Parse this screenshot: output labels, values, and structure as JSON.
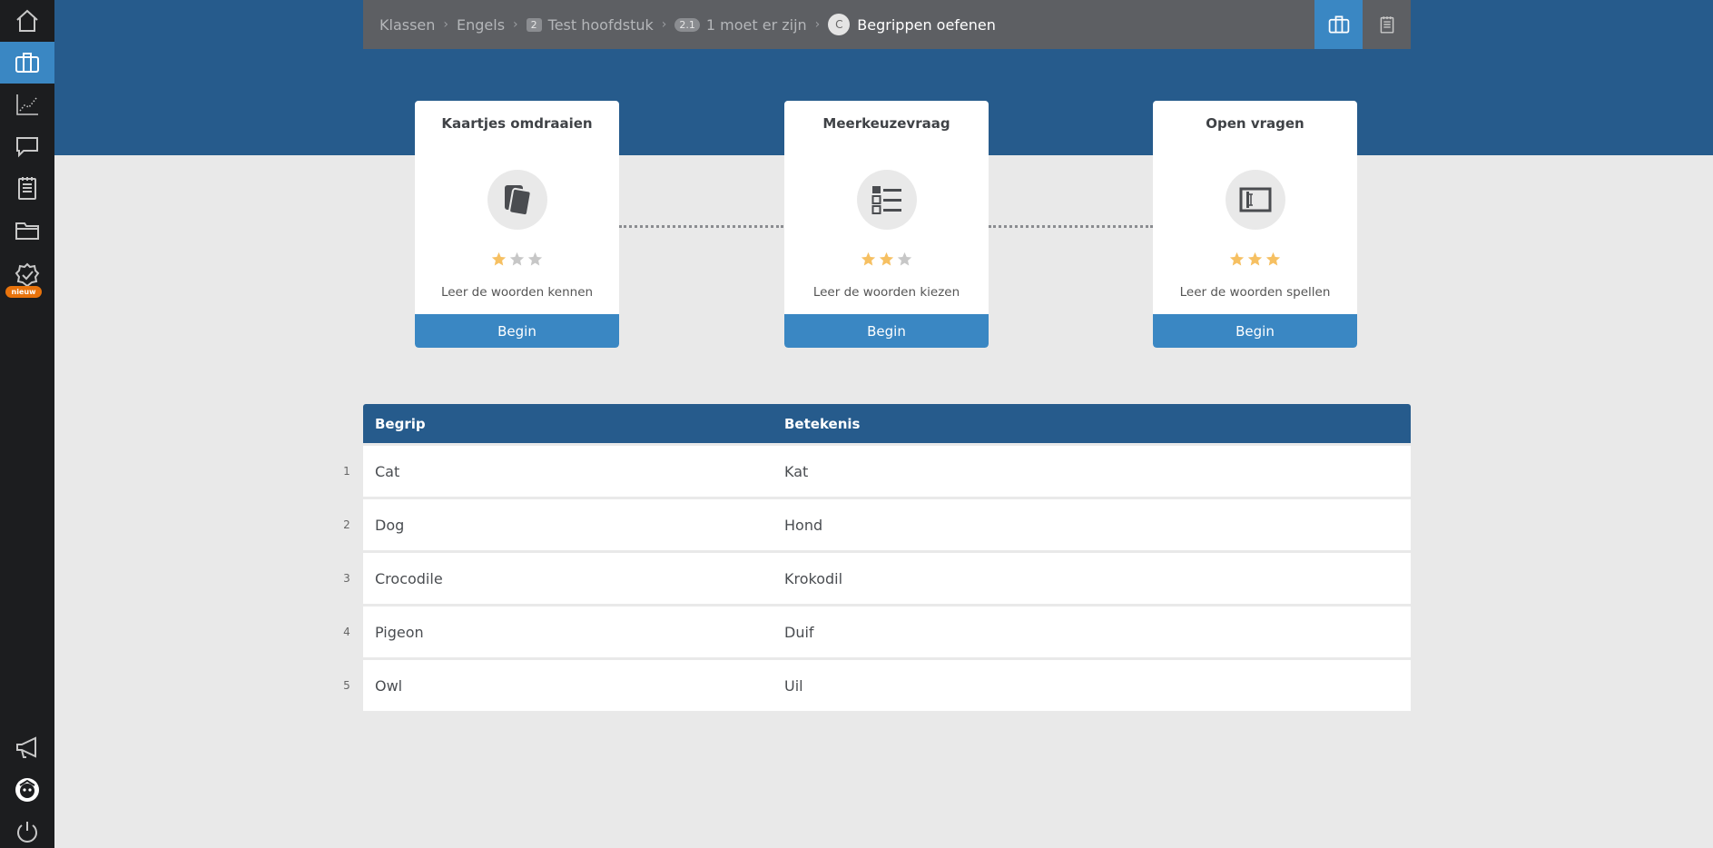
{
  "sidebar": {
    "items": [
      {
        "name": "home-icon"
      },
      {
        "name": "briefcase-icon",
        "active": true
      },
      {
        "name": "chart-icon"
      },
      {
        "name": "chat-icon"
      },
      {
        "name": "notepad-icon"
      },
      {
        "name": "folder-icon"
      },
      {
        "name": "badge-check-icon",
        "badge": "nieuw"
      },
      {
        "name": "megaphone-icon"
      },
      {
        "name": "avatar-icon"
      },
      {
        "name": "power-icon"
      }
    ]
  },
  "breadcrumb": {
    "items": [
      {
        "label": "Klassen"
      },
      {
        "label": "Engels"
      },
      {
        "pill": "2",
        "label": "Test hoofdstuk"
      },
      {
        "pill": "2.1",
        "label": "1 moet er zijn"
      },
      {
        "circle": "C",
        "label": "Begrippen oefenen"
      }
    ]
  },
  "modes": [
    {
      "title": "Kaartjes omdraaien",
      "icon": "cards-icon",
      "stars": 1,
      "max_stars": 3,
      "desc": "Leer de woorden kennen",
      "button": "Begin"
    },
    {
      "title": "Meerkeuzevraag",
      "icon": "list-icon",
      "stars": 2,
      "max_stars": 3,
      "desc": "Leer de woorden kiezen",
      "button": "Begin"
    },
    {
      "title": "Open vragen",
      "icon": "text-input-icon",
      "stars": 3,
      "max_stars": 3,
      "desc": "Leer de woorden spellen",
      "button": "Begin"
    }
  ],
  "table": {
    "headers": [
      "Begrip",
      "Betekenis"
    ],
    "rows": [
      {
        "n": "1",
        "term": "Cat",
        "meaning": "Kat"
      },
      {
        "n": "2",
        "term": "Dog",
        "meaning": "Hond"
      },
      {
        "n": "3",
        "term": "Crocodile",
        "meaning": "Krokodil"
      },
      {
        "n": "4",
        "term": "Pigeon",
        "meaning": "Duif"
      },
      {
        "n": "5",
        "term": "Owl",
        "meaning": "Uil"
      }
    ]
  },
  "colors": {
    "primary": "#3a87c3",
    "header": "#265b8c",
    "star_on": "#f6c062",
    "star_off": "#c7c7c7",
    "badge": "#e8730c"
  }
}
